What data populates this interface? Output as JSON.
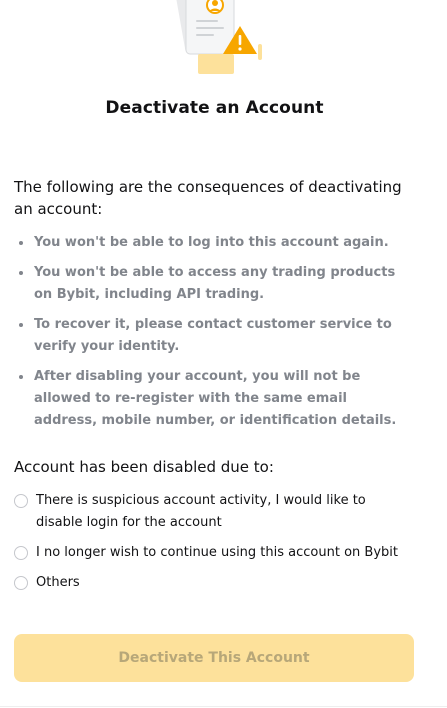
{
  "page": {
    "title": "Deactivate an Account",
    "intro": "The following are the consequences of deactivating an account:",
    "consequences": [
      "You won't be able to log into this account again.",
      "You won't be able to access any trading products on Bybit, including API trading.",
      "To recover it, please contact customer service to verify your identity.",
      "After disabling your account, you will not be allowed to re-register with the same email address, mobile number, or identification details."
    ],
    "reason_heading": "Account has been disabled due to:",
    "reasons": [
      {
        "label": "There is suspicious account activity, I would like to disable login for the account",
        "selected": false
      },
      {
        "label": "I no longer wish to continue using this account on Bybit",
        "selected": false
      },
      {
        "label": "Others",
        "selected": false
      }
    ],
    "submit_label": "Deactivate This Account",
    "submit_enabled": false
  },
  "colors": {
    "accent": "#f7a600",
    "button_disabled_bg": "#fde19b",
    "button_disabled_text": "#b7a779",
    "muted_text": "#81858c"
  },
  "icons": {
    "illustration": "document-warning-icon",
    "radio": "radio-unchecked-icon"
  }
}
